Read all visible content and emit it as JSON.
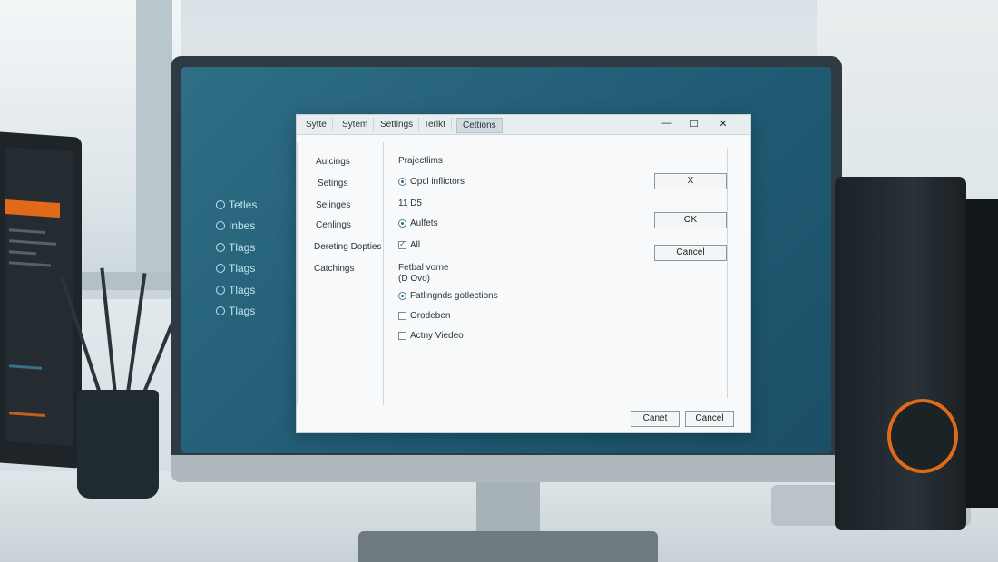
{
  "dialog": {
    "tabs": [
      "Sytte",
      "Sytem",
      "Settings",
      "Terlkt",
      "Cettions"
    ],
    "active_tab_index": 4,
    "window_controls": {
      "minimize": "—",
      "maximize": "☐",
      "close": "✕"
    },
    "nav": [
      "Aulcings",
      "Setings",
      "Selinges",
      "Cenlings",
      "Dereting Dopties",
      "Catchings"
    ],
    "section_title": "Prajectlims",
    "options": {
      "radio_1": "Opcl inflictors",
      "value_text": "11 D5",
      "radio_2": "Aulfets",
      "check_all": "All",
      "field_label": "Fetbal vorne",
      "field_value": "(D Ovo)",
      "radio_3": "Fatlingnds gotlections",
      "check_4": "Orodeben",
      "check_5": "Actny Viedeo"
    },
    "side_buttons": [
      "X",
      "OK",
      "Cancel"
    ],
    "footer_buttons": [
      "Canet",
      "Cancel"
    ]
  },
  "desktop_icons": [
    "Tetles",
    "Inbes",
    "Tlags",
    "Tlags",
    "Tlags",
    "Tlags"
  ],
  "colors": {
    "accent": "#2f6e85",
    "speaker_ring": "#e06a1a"
  }
}
